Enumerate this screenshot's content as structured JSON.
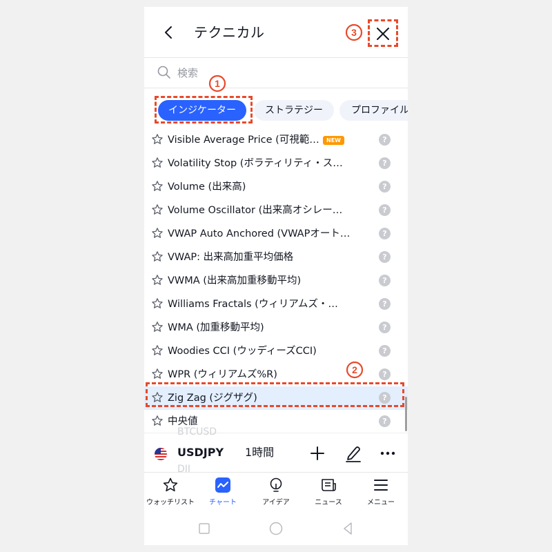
{
  "header": {
    "title": "テクニカル"
  },
  "search": {
    "placeholder": "検索"
  },
  "tabs": [
    {
      "label": "インジケーター",
      "active": true
    },
    {
      "label": "ストラテジー",
      "active": false
    },
    {
      "label": "プロファイル",
      "active": false
    }
  ],
  "indicators": [
    {
      "label": "Visible Average Price (可視範…",
      "badge": "NEW"
    },
    {
      "label": "Volatility Stop (ボラティリティ・ス…"
    },
    {
      "label": "Volume (出来高)"
    },
    {
      "label": "Volume Oscillator (出来高オシレー…"
    },
    {
      "label": "VWAP Auto Anchored (VWAPオート…"
    },
    {
      "label": "VWAP: 出来高加重平均価格"
    },
    {
      "label": "VWMA (出来高加重移動平均)"
    },
    {
      "label": "Williams Fractals (ウィリアムズ・…"
    },
    {
      "label": "WMA (加重移動平均)"
    },
    {
      "label": "Woodies CCI (ウッディーズCCI)"
    },
    {
      "label": "WPR (ウィリアムズ%R)"
    },
    {
      "label": "Zig Zag (ジグザグ)",
      "selected": true
    },
    {
      "label": "中央値"
    }
  ],
  "help_glyph": "?",
  "symbol_bar": {
    "symbol": "USDJPY",
    "interval": "1時間",
    "ghost_above": "BTCUSD",
    "ghost_below": "DJI"
  },
  "bottom_nav": [
    {
      "label": "ウォッチリスト",
      "icon": "star-icon"
    },
    {
      "label": "チャート",
      "icon": "chart-icon",
      "active": true
    },
    {
      "label": "アイデア",
      "icon": "idea-icon"
    },
    {
      "label": "ニュース",
      "icon": "news-icon"
    },
    {
      "label": "メニュー",
      "icon": "menu-icon"
    }
  ],
  "annotations": [
    "1",
    "2",
    "3"
  ],
  "colors": {
    "accent": "#2962ff",
    "annotation": "#e8492a",
    "badge": "#ff9800",
    "selected_row": "#e3effd"
  }
}
